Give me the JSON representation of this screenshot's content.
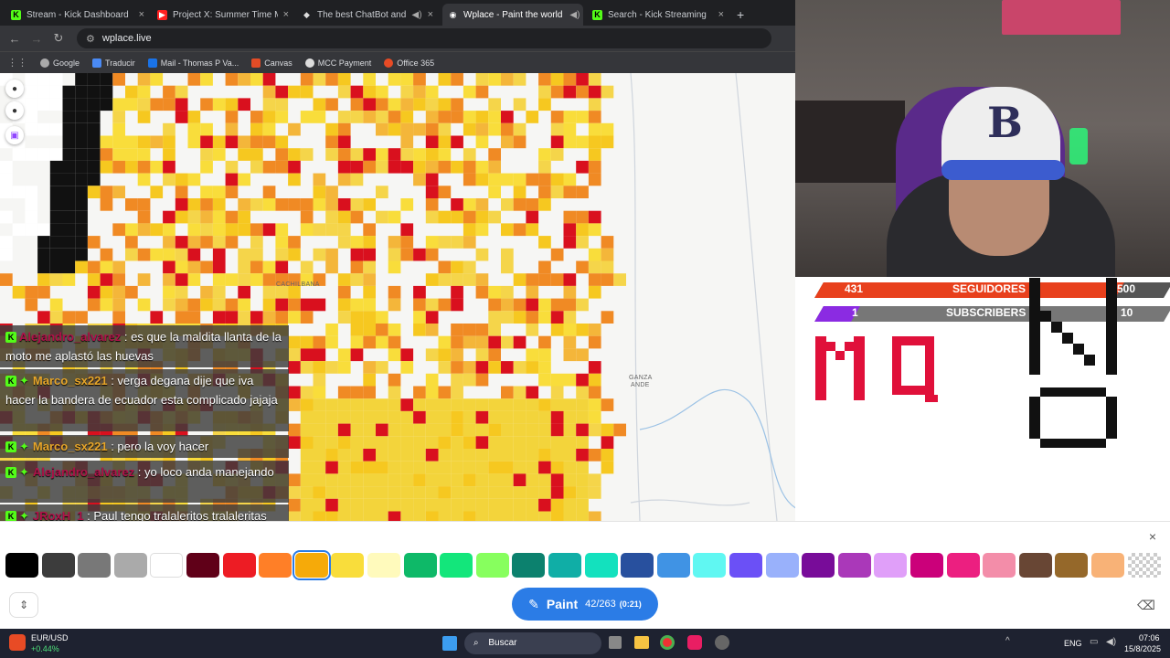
{
  "tabs": [
    {
      "title": "Stream - Kick Dashboard",
      "color": "#53fc18",
      "glyph": "K"
    },
    {
      "title": "Project X: Summer Time Madn",
      "color": "#ff2020",
      "glyph": "▶"
    },
    {
      "title": "The best ChatBot and Widg",
      "color": "#e0e0e0",
      "glyph": "◆"
    },
    {
      "title": "Wplace - Paint the world",
      "color": "#ffffff",
      "glyph": "◉"
    },
    {
      "title": "Search - Kick Streaming",
      "color": "#53fc18",
      "glyph": "K"
    }
  ],
  "tab_close": "×",
  "new_tab": "+",
  "url": "wplace.live",
  "bookmarks": [
    {
      "label": "Google",
      "color": "#aaaaaa"
    },
    {
      "label": "Traducir",
      "color": "#4a8af4"
    },
    {
      "label": "Mail - Thomas P Va...",
      "color": "#1a73e8"
    },
    {
      "label": "Canvas",
      "color": "#e34c26"
    },
    {
      "label": "MCC Payment",
      "color": "#dddddd"
    },
    {
      "label": "Office 365",
      "color": "#e84b25"
    }
  ],
  "map": {
    "labels": [
      "CACHILBANA",
      "GANZA",
      "ANDE"
    ]
  },
  "chat": [
    {
      "user": "Alejandro_alvarez",
      "user_color": "#b0124a",
      "text": "es que la maldita llanta de la moto me aplastó las huevas"
    },
    {
      "user": "Marco_sx221",
      "user_color": "#e8a62a",
      "text": "verga degana dije que iva hacer la bandera de ecuador esta complicado jajaja"
    },
    {
      "user": "Marco_sx221",
      "user_color": "#e8a62a",
      "text": "pero la voy hacer"
    },
    {
      "user": "Alejandro_alvarez",
      "user_color": "#b0124a",
      "text": "yo loco anda manejando"
    },
    {
      "user": "JRoxH_1",
      "user_color": "#b0124a",
      "text": "Paul tengo tralaleritos tralaleritas matellitos orcaleritos tuntunsitos í me faltan los cocodrilitos"
    }
  ],
  "palette": [
    "#000000",
    "#3c3c3c",
    "#787878",
    "#aaaaaa",
    "#ffffff",
    "#600018",
    "#ed1c24",
    "#ff7f27",
    "#f6aa09",
    "#f9dd3b",
    "#fffabc",
    "#0eb968",
    "#13e67b",
    "#87ff5e",
    "#0c816e",
    "#10aea6",
    "#13e1be",
    "#28509e",
    "#4093e4",
    "#60f7f2",
    "#6b50f6",
    "#99b1fb",
    "#780c99",
    "#aa38b9",
    "#e09ff9",
    "#cb007a",
    "#ec1f80",
    "#f38da9",
    "#684634",
    "#95682a",
    "#f8b277",
    "#dddddd"
  ],
  "selected_color_index": 8,
  "paint": {
    "label": "Paint",
    "count": "42/263",
    "timer": "(0:21)"
  },
  "close": "×",
  "overlay": {
    "followers_current": "431",
    "followers_label": "SEGUIDORES",
    "followers_goal": "500",
    "subs_current": "1",
    "subs_label": "SUBSCRIBERS",
    "subs_goal": "10",
    "followers_progress": 0.862,
    "subs_progress": 0.1
  },
  "taskbar": {
    "stock_name": "EUR/USD",
    "stock_change": "+0.44%",
    "search_placeholder": "Buscar",
    "lang": "ENG",
    "time": "07:06",
    "date": "15/8/2025"
  },
  "colors": {
    "accent": "#2b7ce6",
    "followers_bar": "#e8401c",
    "subs_bar": "#8b2be2"
  }
}
